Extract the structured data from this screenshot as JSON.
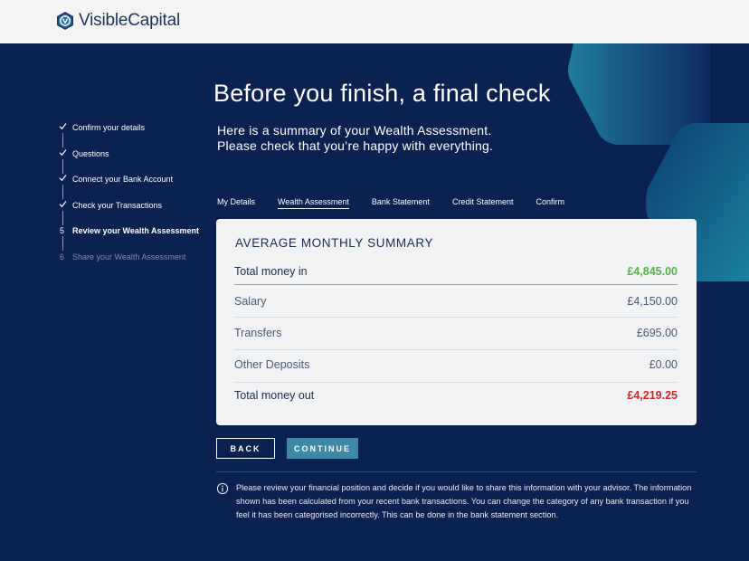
{
  "header": {
    "brand": "VisibleCapital"
  },
  "page": {
    "title": "Before you finish, a final check",
    "subtitle_line1": "Here is a summary of your Wealth Assessment.",
    "subtitle_line2": "Please check that you’re happy with everything."
  },
  "steps": [
    {
      "mark": "check",
      "label": "Confirm your details",
      "state": "done"
    },
    {
      "mark": "check",
      "label": "Questions",
      "state": "done"
    },
    {
      "mark": "check",
      "label": "Connect your Bank Account",
      "state": "done"
    },
    {
      "mark": "check",
      "label": "Check your Transactions",
      "state": "done"
    },
    {
      "mark": "5",
      "label": "Review your Wealth Assessment",
      "state": "active"
    },
    {
      "mark": "6",
      "label": "Share your Wealth Assessment",
      "state": "pending"
    }
  ],
  "tabs": [
    {
      "label": "My Details"
    },
    {
      "label": "Wealth Assessment",
      "active": true
    },
    {
      "label": "Bank Statement"
    },
    {
      "label": "Credit Statement"
    },
    {
      "label": "Confirm"
    }
  ],
  "summary": {
    "title": "AVERAGE MONTHLY SUMMARY",
    "money_in_label": "Total money in",
    "money_in_value": "£4,845.00",
    "rows": [
      {
        "label": "Salary",
        "value": "£4,150.00"
      },
      {
        "label": "Transfers",
        "value": "£695.00"
      },
      {
        "label": "Other Deposits",
        "value": "£0.00"
      }
    ],
    "money_out_label": "Total money out",
    "money_out_value": "£4,219.25"
  },
  "buttons": {
    "back": "BACK",
    "continue": "CONTINUE"
  },
  "info": {
    "text": "Please review your financial position and decide if you would like to share this information with your advisor. The information shown has been calculated from your recent bank transactions. You can change the category of any bank transaction if you feel it has been categorised incorrectly. This can be done in the bank statement section."
  },
  "colors": {
    "background": "#0b2150",
    "accent": "#3e8aa6",
    "money_in": "#58b24a",
    "money_out": "#d0262c"
  }
}
